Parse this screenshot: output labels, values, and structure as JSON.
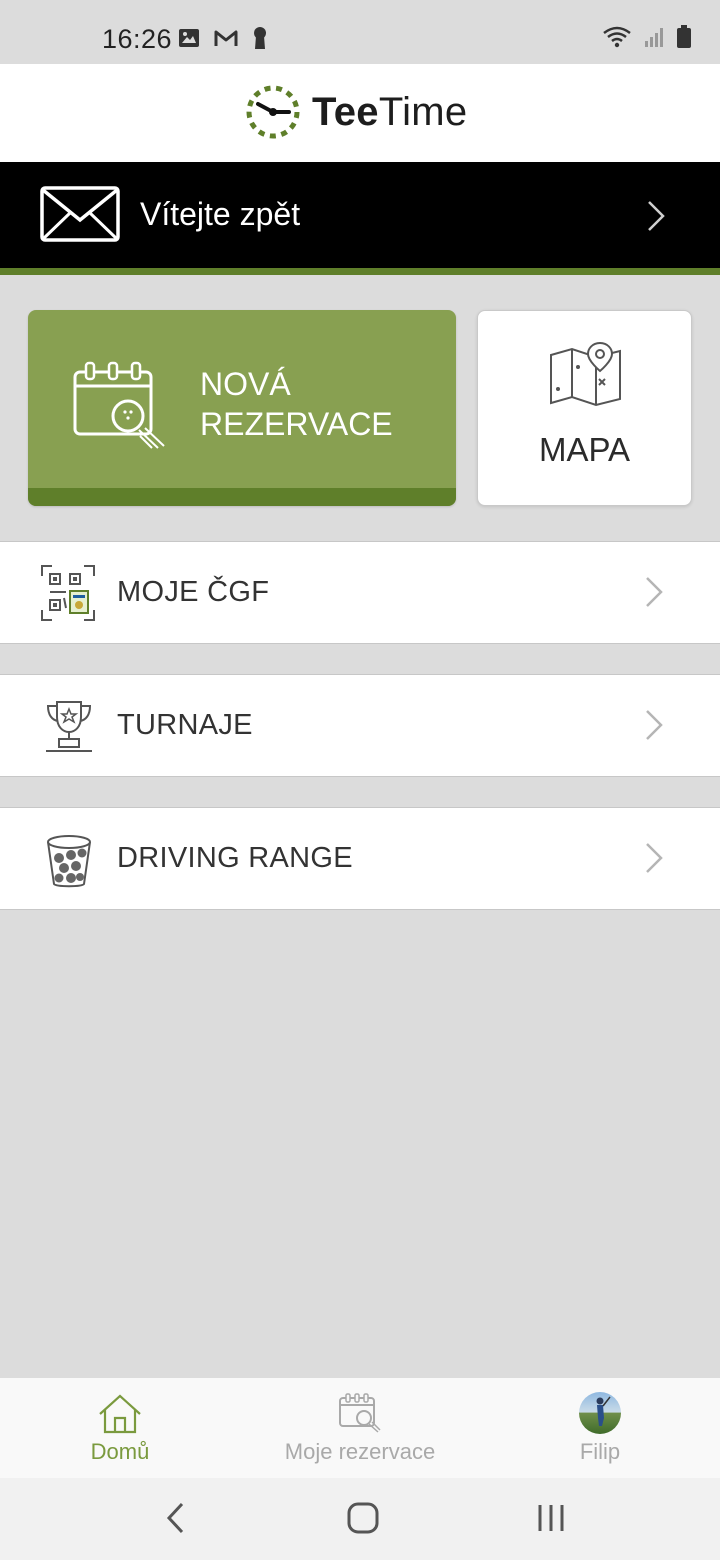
{
  "status_bar": {
    "time": "16:26",
    "left_icons": [
      "image-icon",
      "gmail-icon",
      "keyhole-icon"
    ],
    "right_icons": [
      "wifi-icon",
      "signal-icon",
      "battery-icon"
    ]
  },
  "header": {
    "logo_bold": "Tee",
    "logo_regular": "Time",
    "logo_icon": "clock-icon"
  },
  "welcome_banner": {
    "label": "Vítejte zpět",
    "icon": "envelope-icon"
  },
  "tiles": {
    "new_reservation": {
      "line1": "NOVÁ",
      "line2": "REZERVACE",
      "icon": "calendar-golf-icon"
    },
    "map": {
      "label": "MAPA",
      "icon": "map-pin-icon"
    }
  },
  "menu": [
    {
      "label": "MOJE ČGF",
      "icon": "qr-card-icon"
    },
    {
      "label": "TURNAJE",
      "icon": "trophy-icon"
    },
    {
      "label": "DRIVING RANGE",
      "icon": "ball-bucket-icon"
    }
  ],
  "bottom_nav": [
    {
      "label": "Domů",
      "icon": "home-icon",
      "active": true
    },
    {
      "label": "Moje rezervace",
      "icon": "calendar-icon",
      "active": false
    },
    {
      "label": "Filip",
      "icon": "avatar",
      "active": false
    }
  ],
  "colors": {
    "brand_green": "#88a051",
    "brand_dark_green": "#5f7f2a",
    "active_nav": "#7a9a3e",
    "inactive_nav": "#a9a9a9",
    "background": "#dcdcdc"
  }
}
